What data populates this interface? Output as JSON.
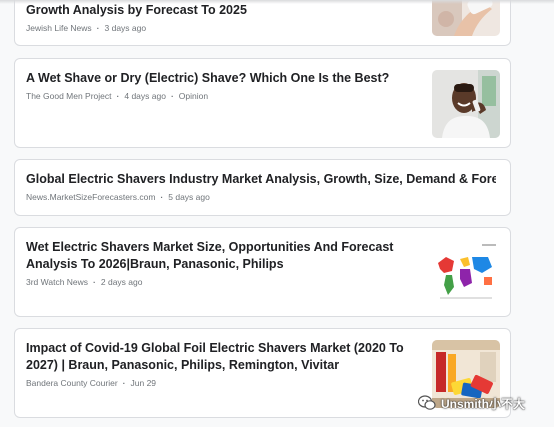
{
  "articles": [
    {
      "title": "Growth Analysis by Forecast To 2025",
      "source": "Jewish Life News",
      "time": "3 days ago",
      "image": "hand-product-photo"
    },
    {
      "title": "A Wet Shave or Dry (Electric) Shave? Which One Is the Best?",
      "source": "The Good Men Project",
      "time": "4 days ago",
      "tag": "Opinion",
      "image": "man-shaving-photo"
    },
    {
      "title": "Global Electric Shavers Industry Market Analysis, Growth, Size, Demand & Forecas",
      "source": "News.MarketSizeForecasters.com",
      "time": "5 days ago"
    },
    {
      "title": "Wet Electric Shavers Market Size, Opportunities And Forecast Analysis To 2026|Braun, Panasonic, Philips",
      "source": "3rd Watch News",
      "time": "2 days ago",
      "image": "world-map-infographic"
    },
    {
      "title": "Impact of Covid-19 Global Foil Electric Shavers Market (2020 To 2027) | Braun, Panasonic, Philips, Remington, Vivitar",
      "source": "Bandera County Courier",
      "time": "Jun 29",
      "image": "store-shelf-cards-photo"
    }
  ],
  "watermark": {
    "text": "Unsmith小不大",
    "icon": "wechat-icon"
  }
}
